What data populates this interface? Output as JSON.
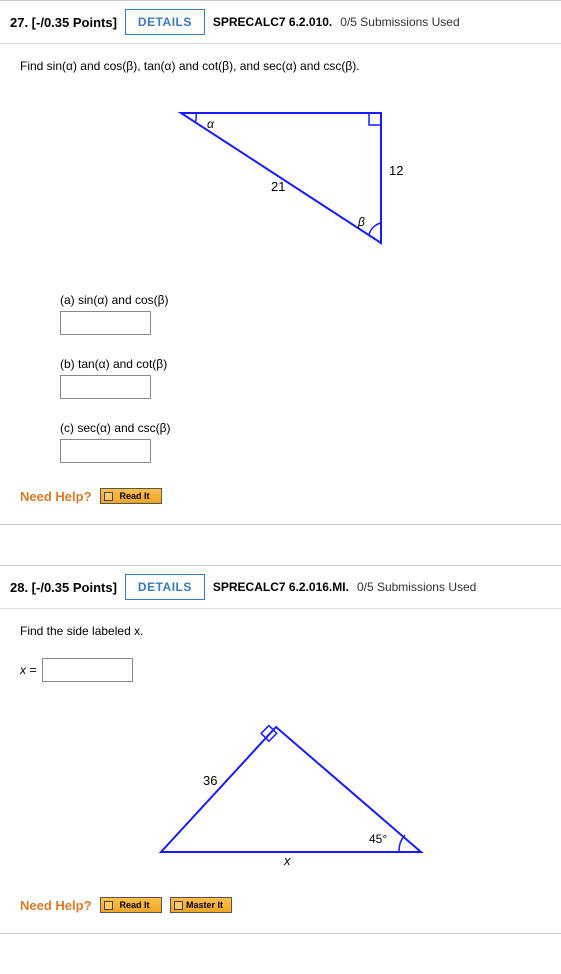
{
  "q27": {
    "header": {
      "num_points": "27. [-/0.35 Points]",
      "details": "DETAILS",
      "source": "SPRECALC7 6.2.010.",
      "submissions": "0/5 Submissions Used"
    },
    "prompt": "Find sin(α) and cos(β), tan(α) and cot(β), and sec(α) and csc(β).",
    "triangle": {
      "alpha": "α",
      "beta": "β",
      "hyp": "21",
      "side": "12"
    },
    "parts": {
      "a": "(a)   sin(α) and cos(β)",
      "b": "(b)   tan(α) and cot(β)",
      "c": "(c)   sec(α) and csc(β)"
    },
    "help": {
      "label": "Need Help?",
      "read": "Read It"
    }
  },
  "q28": {
    "header": {
      "num_points": "28. [-/0.35 Points]",
      "details": "DETAILS",
      "source": "SPRECALC7 6.2.016.MI.",
      "submissions": "0/5 Submissions Used"
    },
    "prompt": "Find the side labeled x.",
    "xlabel": "x =",
    "triangle": {
      "hyp": "36",
      "angle": "45°",
      "base": "x"
    },
    "help": {
      "label": "Need Help?",
      "read": "Read It",
      "master": "Master It"
    }
  }
}
